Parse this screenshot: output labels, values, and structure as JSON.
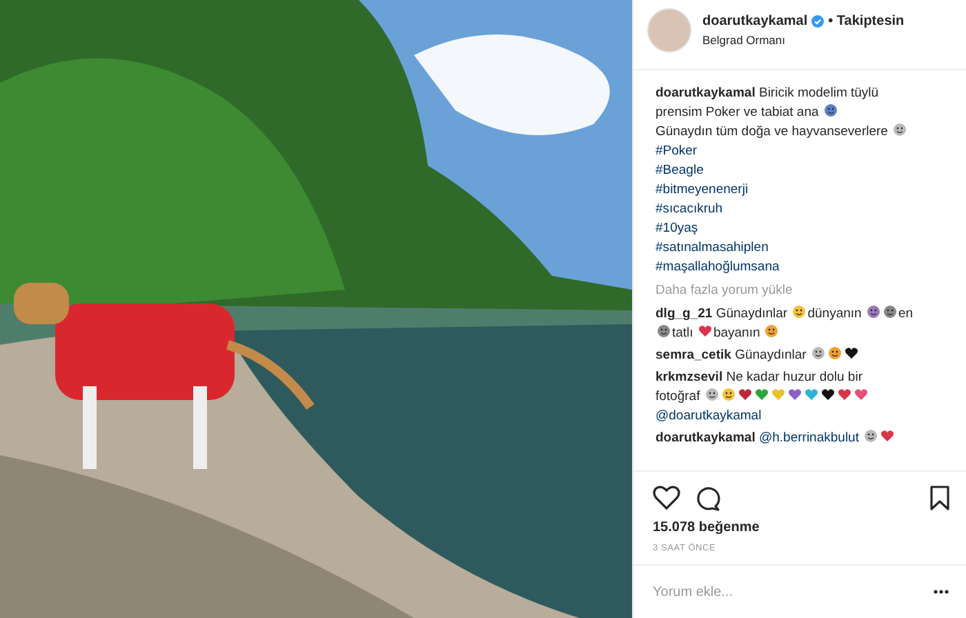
{
  "post": {
    "header": {
      "username": "doarutkaykamal",
      "verified": true,
      "follow_status": "• Takiptesin",
      "location": "Belgrad Ormanı"
    },
    "caption": {
      "username": "doarutkaykamal",
      "segments": [
        {
          "kind": "text",
          "text": "Biricik modelim tüylü"
        },
        {
          "kind": "break"
        },
        {
          "kind": "text",
          "text": "prensim Poker ve tabiat ana"
        },
        {
          "kind": "face",
          "color": "#5b7fc4"
        },
        {
          "kind": "break"
        },
        {
          "kind": "text",
          "text": "Günaydın tüm doğa ve hayvanseverlere"
        },
        {
          "kind": "face",
          "color": "#bbbbbb"
        }
      ],
      "hashtags": [
        "#Poker",
        "#Beagle",
        "#bitmeyenenerji",
        "#sıcacıkruh",
        "#10yaş",
        "#satınalmasahiplen",
        "#maşallahoğlumsana"
      ]
    },
    "load_more": "Daha fazla yorum yükle",
    "comments": [
      {
        "username": "dlg_g_21",
        "segments": [
          {
            "kind": "text",
            "text": "Günaydınlar"
          },
          {
            "kind": "face",
            "color": "#f5c23a"
          },
          {
            "kind": "text",
            "text": "dünyanın"
          },
          {
            "kind": "face",
            "color": "#9a7ab8"
          },
          {
            "kind": "face",
            "color": "#888888"
          },
          {
            "kind": "text",
            "text": "en"
          },
          {
            "kind": "break"
          },
          {
            "kind": "face",
            "color": "#888888"
          },
          {
            "kind": "text",
            "text": "tatlı"
          },
          {
            "kind": "heart",
            "color": "#d9344a"
          },
          {
            "kind": "text",
            "text": "bayanın"
          },
          {
            "kind": "face",
            "color": "#f0a030"
          }
        ]
      },
      {
        "username": "semra_cetik",
        "segments": [
          {
            "kind": "text",
            "text": "Günaydınlar"
          },
          {
            "kind": "face",
            "color": "#bbbbbb"
          },
          {
            "kind": "face",
            "color": "#f0a030"
          },
          {
            "kind": "heart",
            "color": "#111111"
          }
        ]
      },
      {
        "username": "krkmzsevil",
        "segments": [
          {
            "kind": "text",
            "text": "Ne kadar huzur dolu bir"
          },
          {
            "kind": "break"
          },
          {
            "kind": "text",
            "text": "fotoğraf"
          },
          {
            "kind": "face",
            "color": "#bbbbbb"
          },
          {
            "kind": "face",
            "color": "#f5c23a"
          },
          {
            "kind": "heart",
            "color": "#c0273a"
          },
          {
            "kind": "heart",
            "color": "#2fa43a"
          },
          {
            "kind": "heart",
            "color": "#e8c22a"
          },
          {
            "kind": "heart",
            "color": "#8a62c8"
          },
          {
            "kind": "heart",
            "color": "#2bb4d8"
          },
          {
            "kind": "heart",
            "color": "#111111"
          },
          {
            "kind": "heart",
            "color": "#d9344a"
          },
          {
            "kind": "heart",
            "color": "#e8507a"
          },
          {
            "kind": "break"
          },
          {
            "kind": "mention",
            "text": "@doarutkaykamal"
          }
        ]
      },
      {
        "username": "doarutkaykamal",
        "segments": [
          {
            "kind": "mention",
            "text": "@h.berrinakbulut"
          },
          {
            "kind": "face",
            "color": "#bbbbbb"
          },
          {
            "kind": "heart",
            "color": "#d9344a"
          }
        ]
      }
    ],
    "likes": "15.078 beğenme",
    "time": "3 SAAT ÖNCE",
    "comment_field": {
      "placeholder": "Yorum ekle..."
    }
  }
}
